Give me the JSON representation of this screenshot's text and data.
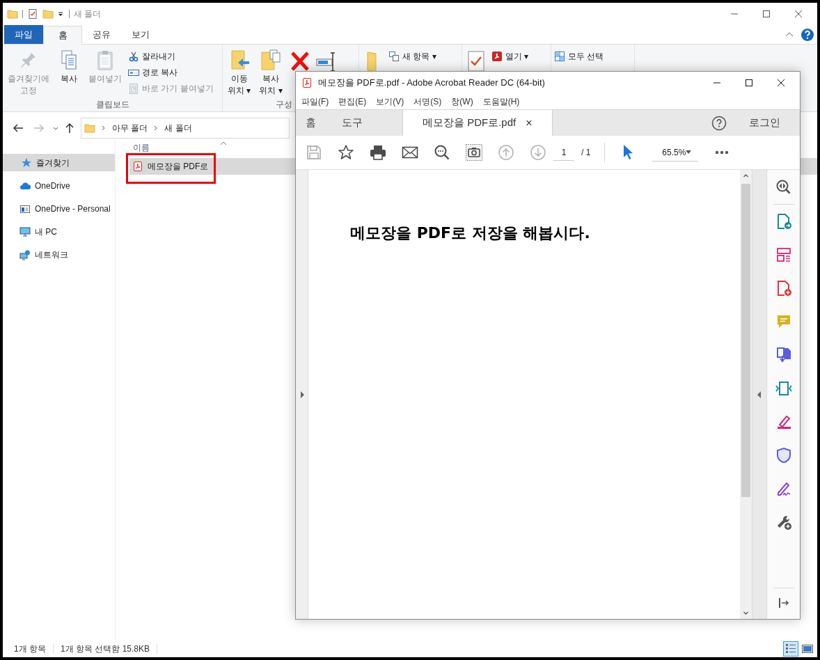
{
  "explorer": {
    "title": "새 폴더",
    "ribbon_tabs": [
      {
        "label": "파일",
        "kind": "file",
        "selected": false
      },
      {
        "label": "홈",
        "kind": "tab",
        "selected": true
      },
      {
        "label": "공유",
        "kind": "tab",
        "selected": false
      },
      {
        "label": "보기",
        "kind": "tab",
        "selected": false
      }
    ],
    "ribbon_groups": [
      {
        "label": "클립보드",
        "large": [
          {
            "lines": [
              "즐겨찾기에",
              "고정"
            ],
            "disabled": true
          },
          {
            "lines": [
              "복사"
            ],
            "disabled": false
          },
          {
            "lines": [
              "붙여넣기"
            ],
            "disabled": true
          }
        ],
        "small": [
          {
            "label": "잘라내기",
            "disabled": false
          },
          {
            "label": "경로 복사",
            "disabled": false
          },
          {
            "label": "바로 가기 붙여넣기",
            "disabled": true
          }
        ]
      },
      {
        "label": "구성",
        "large": [
          {
            "lines": [
              "이동",
              "위치 ▾"
            ],
            "disabled": false
          },
          {
            "lines": [
              "복사",
              "위치 ▾"
            ],
            "disabled": false
          },
          {
            "disabled": false
          },
          {
            "disabled": false
          }
        ]
      },
      {
        "large": [
          {
            "disabled": false
          }
        ],
        "small": [
          {
            "label": "새 항목 ▾",
            "disabled": false
          }
        ]
      },
      {
        "large": [
          {
            "disabled": false
          }
        ],
        "small": [
          {
            "label": "열기 ▾",
            "disabled": false
          }
        ]
      },
      {
        "small": [
          {
            "label": "모두 선택",
            "disabled": false
          }
        ]
      }
    ],
    "address": [
      "아무 폴더",
      "새 폴더"
    ],
    "sidebar": [
      {
        "label": "즐겨찾기",
        "selected": true
      },
      {
        "label": "OneDrive",
        "selected": false
      },
      {
        "label": "OneDrive - Personal",
        "selected": false
      },
      {
        "label": "내 PC",
        "selected": false
      },
      {
        "label": "네트워크",
        "selected": false
      }
    ],
    "file_list": {
      "columns": [
        "이름"
      ],
      "rows": [
        {
          "name": "메모장을 PDF로",
          "selected": true,
          "highlighted": true
        }
      ]
    },
    "status_bar": [
      "1개 항목",
      "1개 항목 선택함 15.8KB"
    ],
    "view_buttons": [
      {
        "selected": true
      },
      {
        "selected": false
      }
    ]
  },
  "acrobat": {
    "title": "메모장을 PDF로.pdf - Adobe Acrobat Reader DC (64-bit)",
    "menu": [
      "파일(F)",
      "편집(E)",
      "보기(V)",
      "서명(S)",
      "창(W)",
      "도움말(H)"
    ],
    "tabs": [
      {
        "label": "홈",
        "selected": false
      },
      {
        "label": "도구",
        "selected": false
      },
      {
        "label": "메모장을 PDF로.pdf",
        "selected": true,
        "close": "×"
      }
    ],
    "login": "로그인",
    "toolbar_buttons": [
      {
        "disabled": true
      },
      {
        "disabled": false
      },
      {
        "disabled": false
      },
      {
        "disabled": false
      },
      {
        "disabled": false
      },
      {
        "disabled": false
      },
      {
        "disabled": true
      },
      {
        "disabled": true
      }
    ],
    "page": "1",
    "page_total": "/ 1",
    "zoom": "65.5%",
    "document_text": "메모장을 PDF로 저장을 해봅시다."
  }
}
